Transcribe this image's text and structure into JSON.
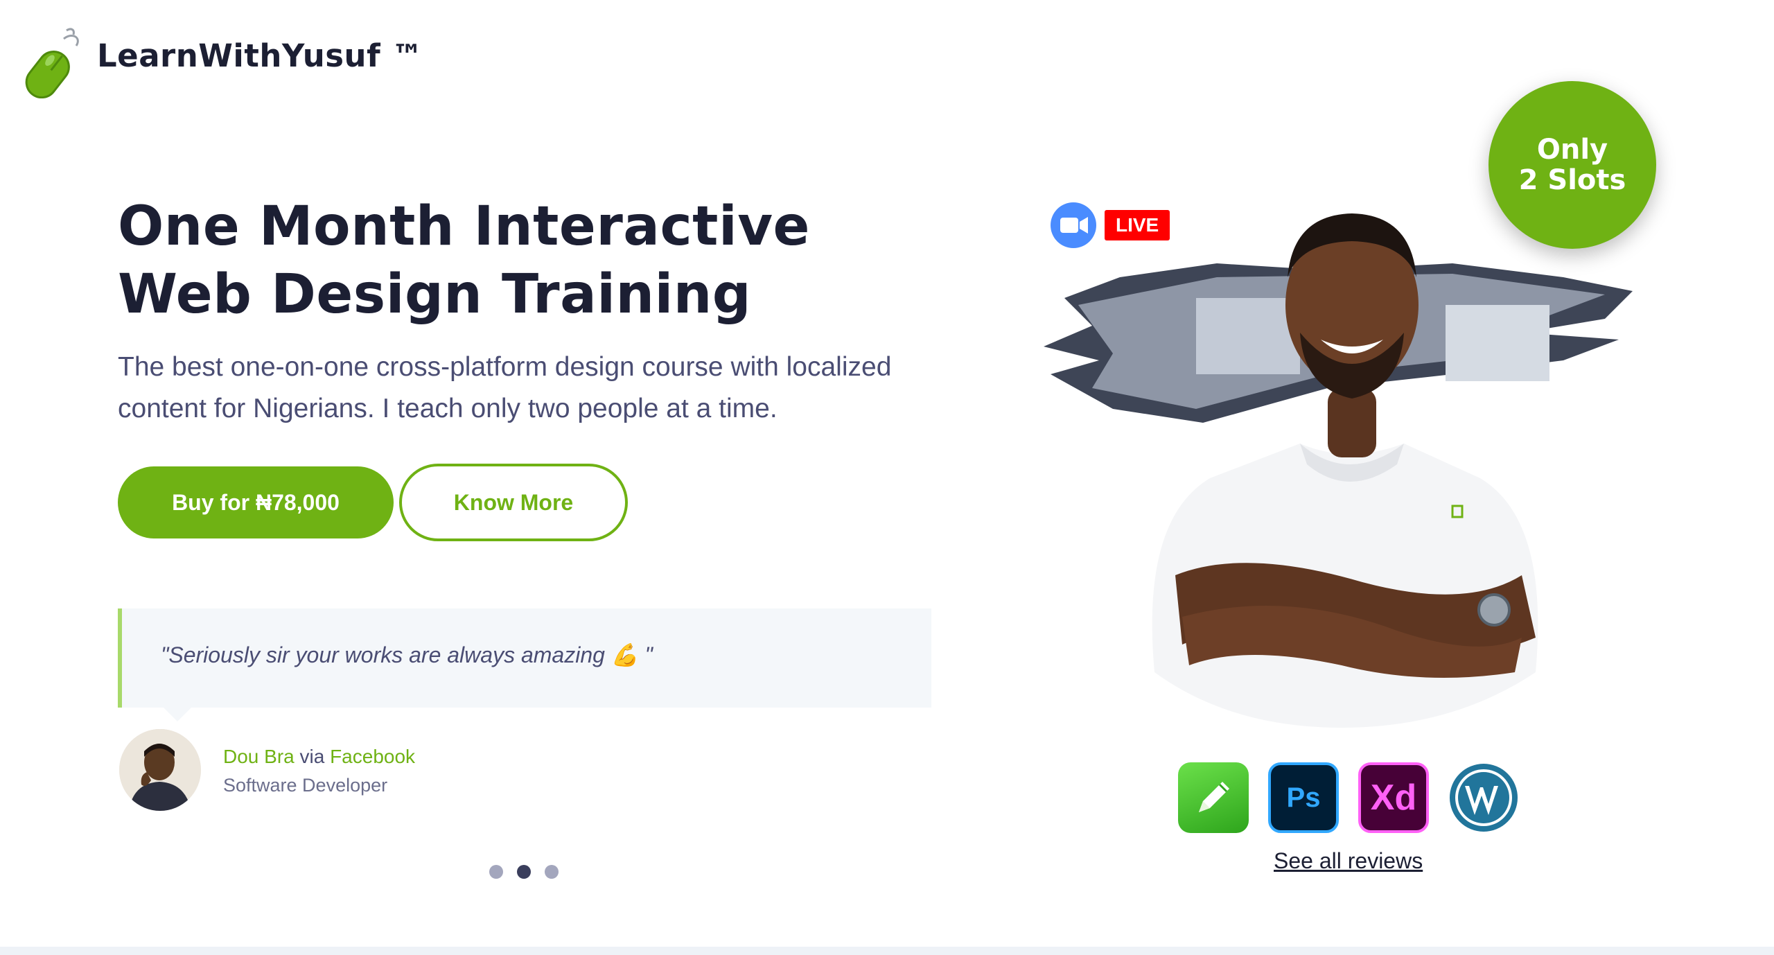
{
  "brand": {
    "name": "LearnWithYusuf ™"
  },
  "hero": {
    "headline_line1": "One Month Interactive",
    "headline_line2": "Web Design Training",
    "subhead": "The best one-on-one cross-platform design course with localized content for Nigerians. I teach only two people at a time.",
    "buy_button": "Buy for ₦78,000",
    "know_more_button": "Know More"
  },
  "testimonial": {
    "quote": "\"Seriously sir your works are always amazing 💪 \"",
    "author": "Dou Bra",
    "via": "via",
    "source": "Facebook",
    "role": "Software Developer",
    "slides_total": 3,
    "active_slide": 2
  },
  "visual": {
    "live_label": "LIVE",
    "slots_line1": "Only",
    "slots_line2": "2 Slots",
    "tools": [
      "vectornator-icon",
      "photoshop-icon",
      "adobe-xd-icon",
      "wordpress-icon"
    ],
    "ps_label": "Ps",
    "xd_label": "Xd",
    "see_all_reviews": "See all reviews"
  },
  "colors": {
    "accent_green": "#6fb214",
    "heading": "#1c1f33",
    "body_text": "#4a4d73",
    "live_red": "#ff0000",
    "zoom_blue": "#4a8cff"
  }
}
